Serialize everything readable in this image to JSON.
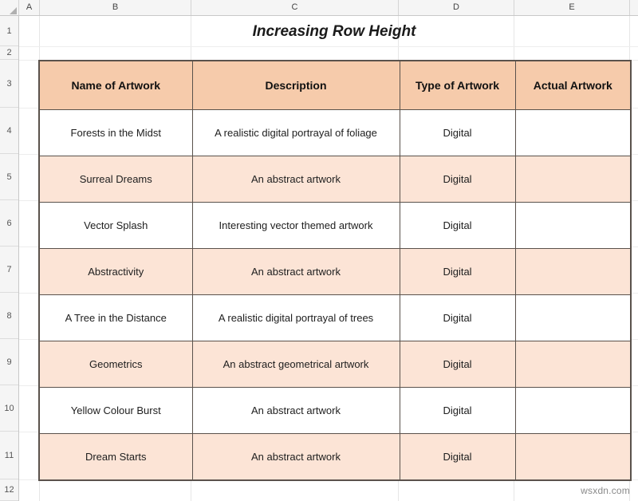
{
  "app": {
    "title": "Increasing Row Height",
    "watermark": "wsxdn.com"
  },
  "grid": {
    "column_headers": [
      "A",
      "B",
      "C",
      "D",
      "E"
    ],
    "row_headers": [
      "1",
      "2",
      "3",
      "4",
      "5",
      "6",
      "7",
      "8",
      "9",
      "10",
      "11",
      "12"
    ],
    "corner_icon": "select-all-triangle-icon"
  },
  "colors": {
    "header_fill": "#F6CBAB",
    "alt_row_fill": "#FCE4D6",
    "plain_row_fill": "#FFFFFF",
    "border": "#5A524C",
    "gridline": "#E6E6E6",
    "header_strip": "#F5F5F5"
  },
  "table": {
    "headers": [
      "Name of Artwork",
      "Description",
      "Type of Artwork",
      "Actual Artwork"
    ],
    "rows": [
      {
        "name": "Forests in the Midst",
        "description": "A realistic digital portrayal of  foliage",
        "type": "Digital",
        "actual": ""
      },
      {
        "name": "Surreal Dreams",
        "description": "An abstract artwork",
        "type": "Digital",
        "actual": ""
      },
      {
        "name": "Vector Splash",
        "description": "Interesting vector themed artwork",
        "type": "Digital",
        "actual": ""
      },
      {
        "name": "Abstractivity",
        "description": "An abstract artwork",
        "type": "Digital",
        "actual": ""
      },
      {
        "name": "A Tree in the Distance",
        "description": "A realistic digital portrayal of trees",
        "type": "Digital",
        "actual": ""
      },
      {
        "name": "Geometrics",
        "description": "An abstract geometrical artwork",
        "type": "Digital",
        "actual": ""
      },
      {
        "name": "Yellow Colour Burst",
        "description": "An abstract artwork",
        "type": "Digital",
        "actual": ""
      },
      {
        "name": "Dream Starts",
        "description": "An abstract artwork",
        "type": "Digital",
        "actual": ""
      }
    ]
  }
}
